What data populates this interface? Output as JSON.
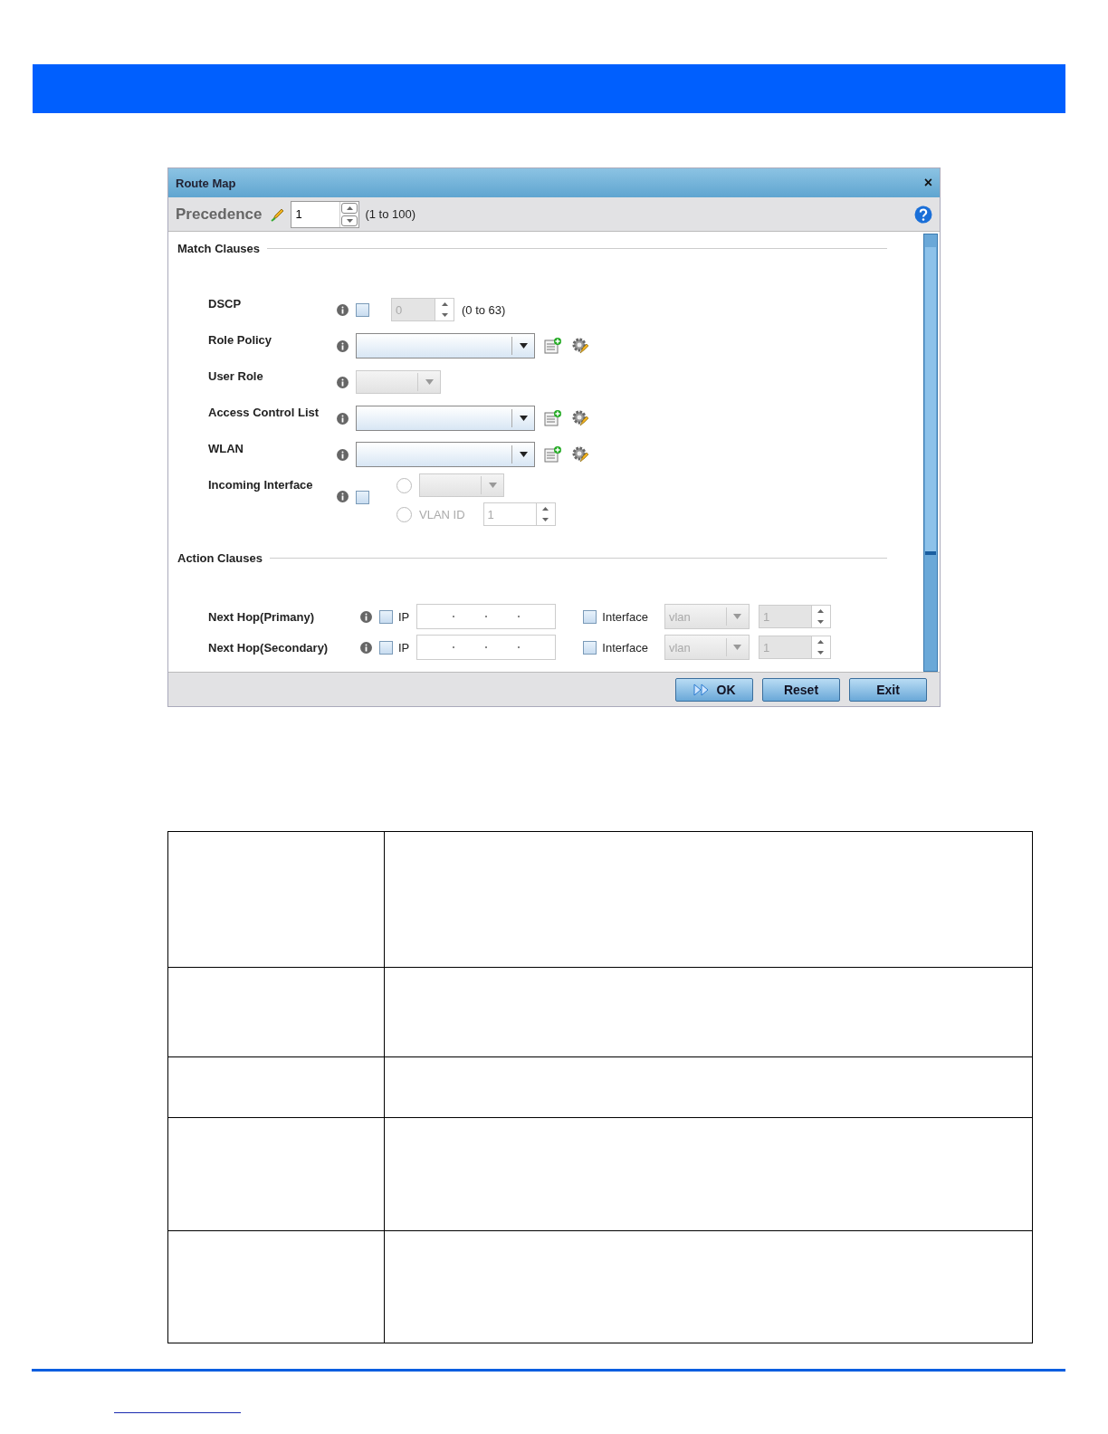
{
  "dialog": {
    "title": "Route Map",
    "close": "×",
    "precedence": {
      "label": "Precedence",
      "value": "1",
      "range": "(1 to 100)"
    },
    "match_clauses": {
      "title": "Match Clauses",
      "rows": [
        {
          "kind": "spinner",
          "label": "DSCP",
          "checked": false,
          "value": "0",
          "range": "(0 to 63)"
        },
        {
          "kind": "select_actions",
          "label": "Role Policy"
        },
        {
          "kind": "small_select",
          "label": "User Role"
        },
        {
          "kind": "select_actions",
          "label": "Access Control List"
        },
        {
          "kind": "select_actions",
          "label": "WLAN"
        },
        {
          "kind": "interface",
          "label": "Incoming Interface",
          "checked": false,
          "radios": [
            {
              "selected": false
            },
            {
              "selected": false,
              "label": "VLAN ID",
              "value": "1"
            }
          ]
        }
      ]
    },
    "action_clauses": {
      "title": "Action Clauses",
      "rows": [
        {
          "kind": "next_hop",
          "label": "Next Hop(Primany)",
          "ip_checked": false,
          "ip_label": "IP",
          "if_checked": false,
          "if_label": "Interface",
          "if_value": "vlan",
          "spin_value": "1"
        },
        {
          "kind": "next_hop",
          "label": "Next Hop(Secondary)",
          "ip_checked": false,
          "ip_label": "IP",
          "if_checked": false,
          "if_label": "Interface",
          "if_value": "vlan",
          "spin_value": "1"
        }
      ]
    },
    "buttons": [
      "OK",
      "Reset",
      "Exit"
    ]
  }
}
